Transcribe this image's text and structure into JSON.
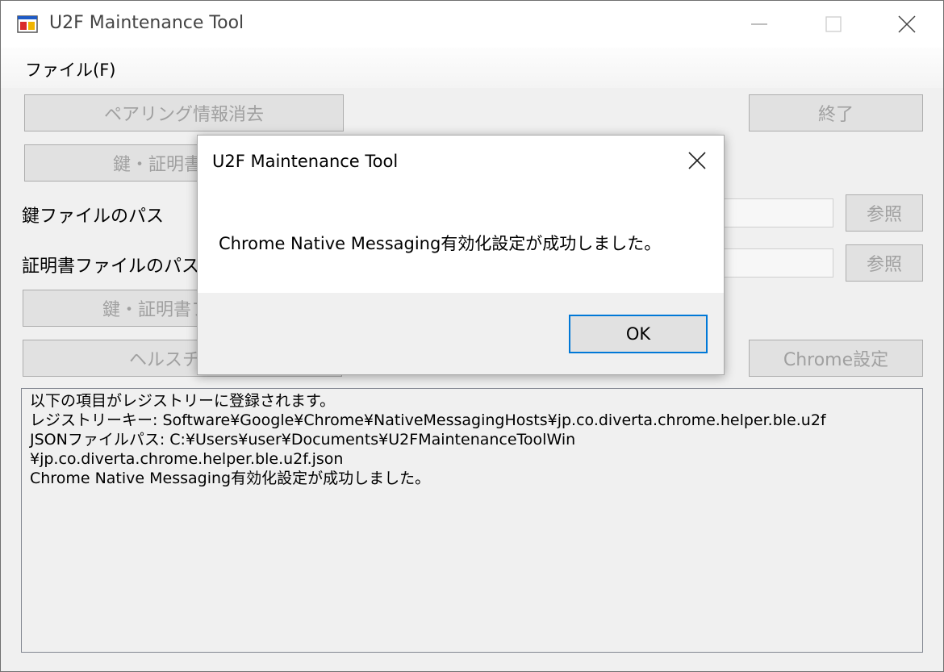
{
  "window": {
    "title": "U2F Maintenance Tool",
    "icon": "app-window-icon",
    "controls": {
      "minimize": "minimize-icon",
      "maximize": "maximize-icon",
      "close": "close-icon"
    }
  },
  "menu": {
    "file": "ファイル(F)"
  },
  "buttons": {
    "clear_pairing": "ペアリング情報消去",
    "exit": "終了",
    "key_cert_key": "鍵・証明書・キー",
    "browse1": "参照",
    "browse2": "参照",
    "key_cert_file": "鍵・証明書ファイル",
    "health_check": "ヘルスチェッ",
    "chrome_settings": "Chrome設定"
  },
  "labels": {
    "key_file_path": "鍵ファイルのパス",
    "cert_file_path": "証明書ファイルのパス"
  },
  "log": {
    "lines": [
      "以下の項目がレジストリーに登録されます。",
      "レジストリーキー: Software¥Google¥Chrome¥NativeMessagingHosts¥jp.co.diverta.chrome.helper.ble.u2f",
      " JSONファイルパス: C:¥Users¥user¥Documents¥U2FMaintenanceToolWin",
      "¥jp.co.diverta.chrome.helper.ble.u2f.json",
      "Chrome Native Messaging有効化設定が成功しました。"
    ]
  },
  "dialog": {
    "title": "U2F Maintenance Tool",
    "message": "Chrome Native Messaging有効化設定が成功しました。",
    "ok": "OK"
  },
  "colors": {
    "accent": "#0078d7",
    "disabled_text": "#a0a0a0",
    "background": "#f0f0f0"
  }
}
